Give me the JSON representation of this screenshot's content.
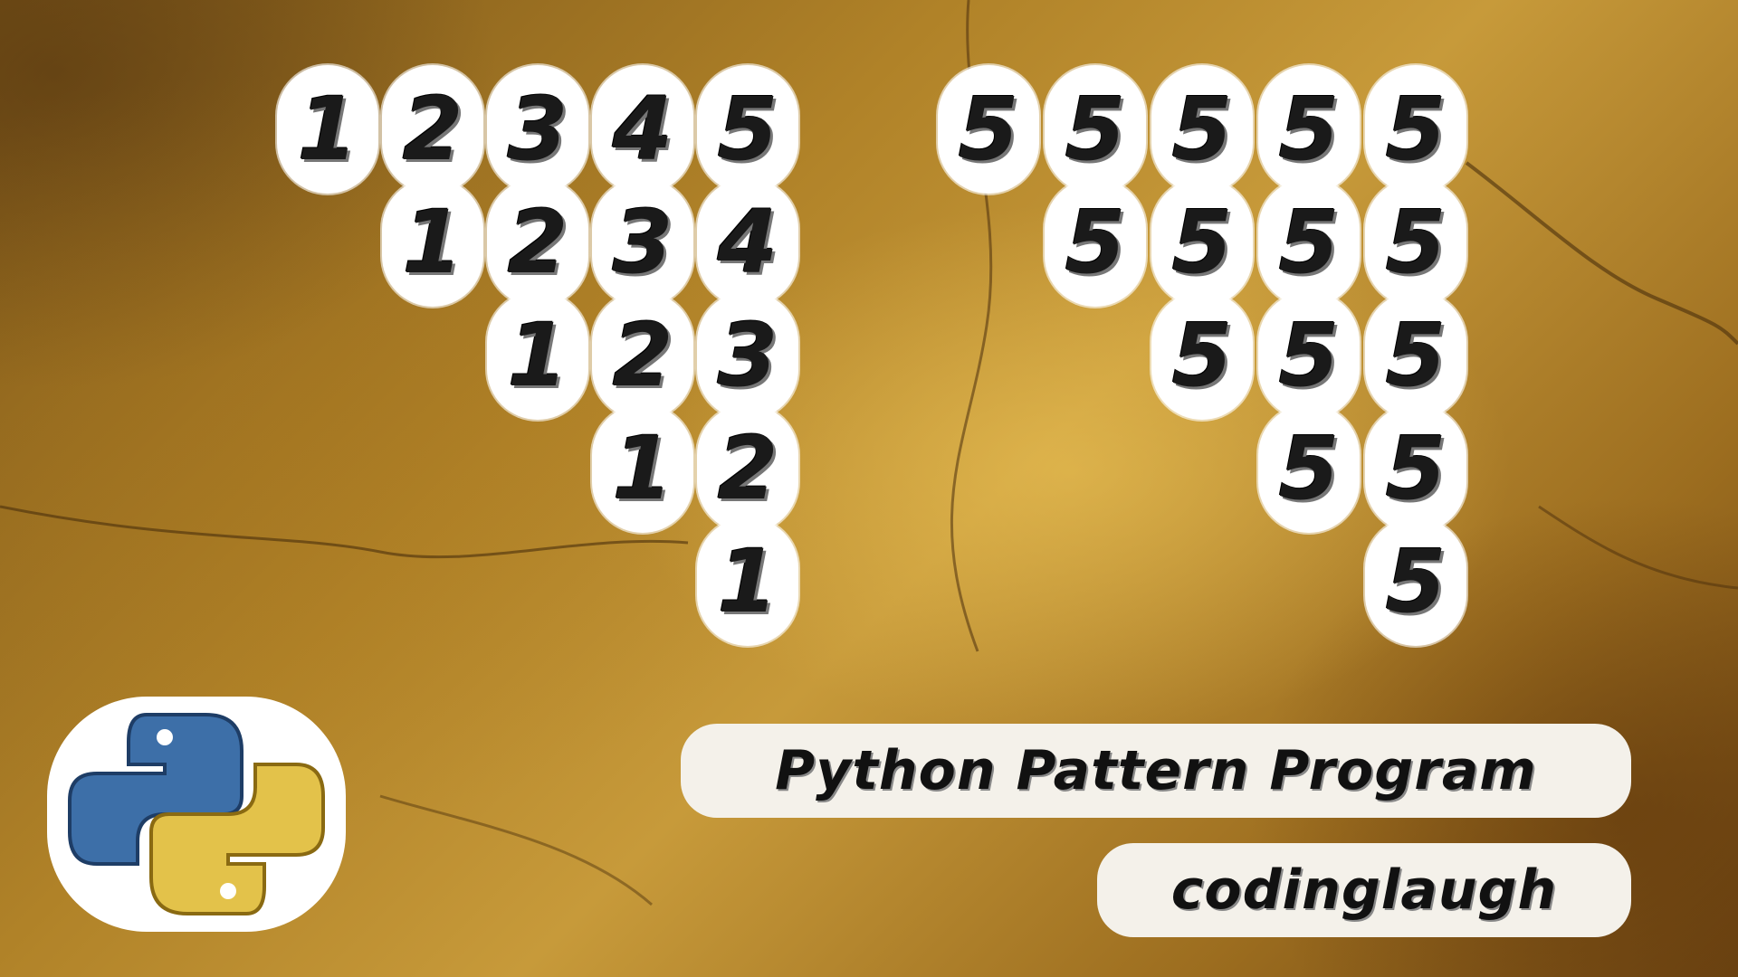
{
  "pattern_left": {
    "rows": [
      [
        "1",
        "2",
        "3",
        "4",
        "5"
      ],
      [
        "1",
        "2",
        "3",
        "4"
      ],
      [
        "1",
        "2",
        "3"
      ],
      [
        "1",
        "2"
      ],
      [
        "1"
      ]
    ]
  },
  "pattern_right": {
    "rows": [
      [
        "5",
        "5",
        "5",
        "5",
        "5"
      ],
      [
        "5",
        "5",
        "5",
        "5"
      ],
      [
        "5",
        "5",
        "5"
      ],
      [
        "5",
        "5"
      ],
      [
        "5"
      ]
    ]
  },
  "caption": {
    "title": "Python Pattern Program",
    "channel": "codinglaugh"
  },
  "logo": {
    "icon": "python-logo-icon",
    "colors": {
      "blue": "#3d6fa8",
      "yellow": "#e3c24a"
    }
  },
  "colors": {
    "background": "#b08228",
    "badge": "#ffffff",
    "text": "#1a1a1a"
  }
}
